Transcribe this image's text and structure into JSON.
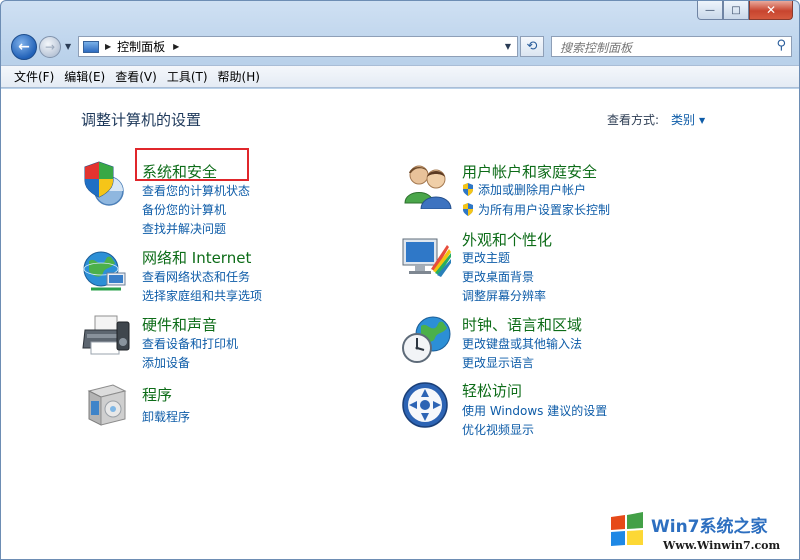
{
  "window": {
    "caption_buttons": {
      "minimize": "—",
      "maximize": "□",
      "close": "✕"
    }
  },
  "navbar": {
    "back_glyph": "←",
    "forward_glyph": "→",
    "breadcrumb": "控制面板",
    "refresh_glyph": "⟲",
    "search_placeholder": "搜索控制面板"
  },
  "menubar": {
    "items": [
      "文件(F)",
      "编辑(E)",
      "查看(V)",
      "工具(T)",
      "帮助(H)"
    ]
  },
  "content": {
    "heading": "调整计算机的设置",
    "view_by_label": "查看方式:",
    "view_by_value": "类别",
    "categories": [
      {
        "title": "系统和安全",
        "icon": "system-security-icon",
        "links": [
          "查看您的计算机状态",
          "备份您的计算机",
          "查找并解决问题"
        ]
      },
      {
        "title": "网络和 Internet",
        "icon": "network-globe-icon",
        "links": [
          "查看网络状态和任务",
          "选择家庭组和共享选项"
        ]
      },
      {
        "title": "硬件和声音",
        "icon": "printer-hardware-icon",
        "links": [
          "查看设备和打印机",
          "添加设备"
        ]
      },
      {
        "title": "程序",
        "icon": "programs-box-icon",
        "links": [
          "卸载程序"
        ]
      },
      {
        "title": "用户帐户和家庭安全",
        "icon": "user-accounts-icon",
        "links": [
          "添加或删除用户帐户",
          "为所有用户设置家长控制"
        ]
      },
      {
        "title": "外观和个性化",
        "icon": "appearance-monitor-icon",
        "links": [
          "更改主题",
          "更改桌面背景",
          "调整屏幕分辨率"
        ]
      },
      {
        "title": "时钟、语言和区域",
        "icon": "clock-globe-icon",
        "links": [
          "更改键盘或其他输入法",
          "更改显示语言"
        ]
      },
      {
        "title": "轻松访问",
        "icon": "ease-of-access-icon",
        "links": [
          "使用 Windows 建议的设置",
          "优化视频显示"
        ]
      }
    ]
  },
  "watermark": {
    "brand": "Win7系统之家",
    "url": "Www.Winwin7.com"
  },
  "colors": {
    "category_title": "#0d6c18",
    "link": "#0e5ca8",
    "highlight_box": "#e0262b",
    "frame": "#b9d1ea"
  }
}
